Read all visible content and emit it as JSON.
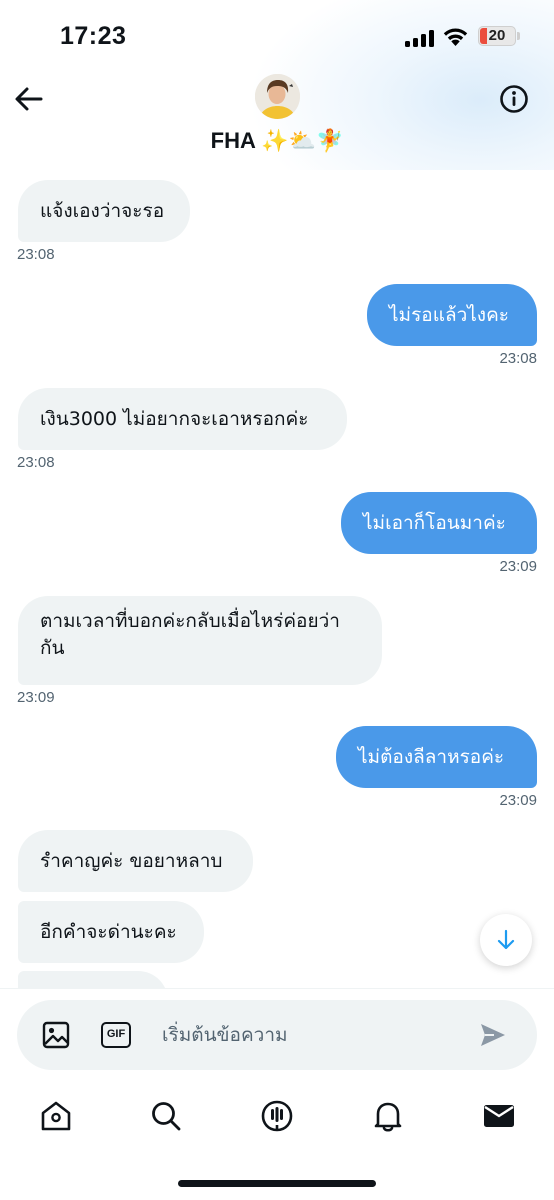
{
  "status_bar": {
    "time": "17:23",
    "battery_level": "20",
    "battery_color": "#eb4d3d"
  },
  "header": {
    "contact_name": "FHA",
    "contact_emoji": "✨⛅🧚",
    "back_icon": "arrow-left-icon",
    "info_icon": "info-circle-icon"
  },
  "messages": [
    {
      "direction": "in",
      "text": "แจ้งเองว่าจะรอ",
      "time": "23:08"
    },
    {
      "direction": "out",
      "text": "ไม่รอแล้วไงคะ",
      "time": "23:08"
    },
    {
      "direction": "in",
      "text": "เงิน3000 ไม่อยากจะเอาหรอกค่ะ",
      "time": "23:08"
    },
    {
      "direction": "out",
      "text": "ไม่เอาก็โอนมาค่ะ",
      "time": "23:09"
    },
    {
      "direction": "in",
      "text": "ตามเวลาที่บอกค่ะกลับเมื่อไหร่ค่อยว่ากัน",
      "line1": "ตามเวลาที่บอกค่ะกลับเมื่อไหร่ค่อยว่า",
      "line2": "กัน",
      "time": "23:09"
    },
    {
      "direction": "out",
      "text": "ไม่ต้องลีลาหรอค่ะ",
      "time": "23:09"
    },
    {
      "direction": "in",
      "text": "รำคาญค่ะ ขอยาหลาบ"
    },
    {
      "direction": "in",
      "text": "อีกคำจะด่านะคะ"
    }
  ],
  "composer": {
    "placeholder": "เริ่มต้นข้อความ",
    "gif_label": "GIF",
    "image_icon": "image-icon",
    "send_icon": "send-icon"
  },
  "scroll_down_icon": "arrow-down-icon",
  "bottom_nav": [
    {
      "name": "home",
      "icon": "home-icon"
    },
    {
      "name": "search",
      "icon": "search-icon"
    },
    {
      "name": "spaces",
      "icon": "spaces-microphone-icon"
    },
    {
      "name": "notifications",
      "icon": "bell-icon"
    },
    {
      "name": "messages",
      "icon": "envelope-icon",
      "active": true
    }
  ],
  "colors": {
    "outgoing_bubble": "#4a99e9",
    "incoming_bubble": "#eff3f4",
    "timestamp": "#536471"
  }
}
